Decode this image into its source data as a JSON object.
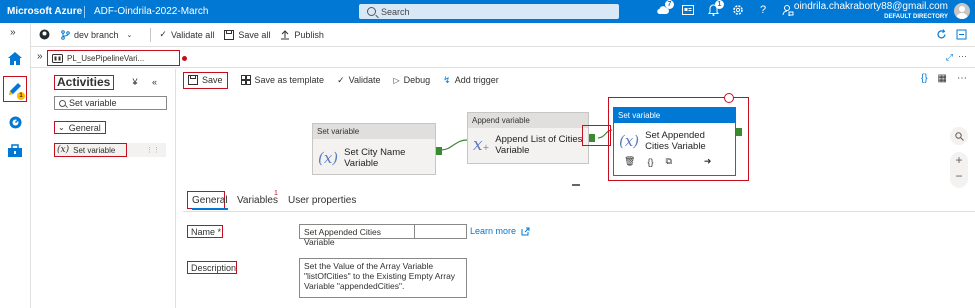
{
  "topbar": {
    "brand": "Microsoft Azure",
    "factory_name": "ADF-Oindrila-2022-March",
    "search_placeholder": "Search",
    "icons": [
      "cloud-shell-icon",
      "portal-directory-icon",
      "notifications-icon",
      "settings-icon",
      "help-icon",
      "feedback-icon"
    ],
    "badges": {
      "cloud_shell": "7",
      "notifications": "1"
    },
    "account_email": "oindrila.chakraborty88@gmail.com",
    "account_directory": "DEFAULT DIRECTORY"
  },
  "rail": {
    "expand": "»",
    "icons": [
      "home-icon",
      "author-pencil-icon",
      "monitor-icon",
      "manage-toolbox-icon"
    ],
    "author_badge": "1"
  },
  "toolbar": {
    "branch": "dev branch",
    "validate_all": "Validate all",
    "save_all": "Save all",
    "publish": "Publish"
  },
  "tab": {
    "chevron": "»",
    "pipeline_name": "PL_UsePipelineVari..."
  },
  "activities": {
    "title": "Activities",
    "controls": "¥ «",
    "search_value": "Set variable",
    "group": "General",
    "item": "Set variable"
  },
  "canvas_toolbar": {
    "save": "Save",
    "save_as_template": "Save as template",
    "validate": "Validate",
    "debug": "Debug",
    "add_trigger": "Add trigger"
  },
  "cards": [
    {
      "type": "Set variable",
      "name": "Set City Name Variable"
    },
    {
      "type": "Append variable",
      "name": "Append List of Cities Variable"
    },
    {
      "type": "Set variable",
      "name": "Set Appended Cities Variable"
    }
  ],
  "props": {
    "tabs": [
      "General",
      "Variables",
      "User properties"
    ],
    "variables_badge": "1",
    "name_label": "Name *",
    "name_value": "Set Appended Cities Variable",
    "learn_more": "Learn more",
    "description_label": "Description",
    "description_value": "Set the Value of the Array Variable \"listOfCities\" to the Existing Empty Array Variable \"appendedCities\"."
  },
  "colors": {
    "azure_blue": "#0078d4",
    "annotation_red": "#c50f1f",
    "success_green": "#3a8a32"
  }
}
